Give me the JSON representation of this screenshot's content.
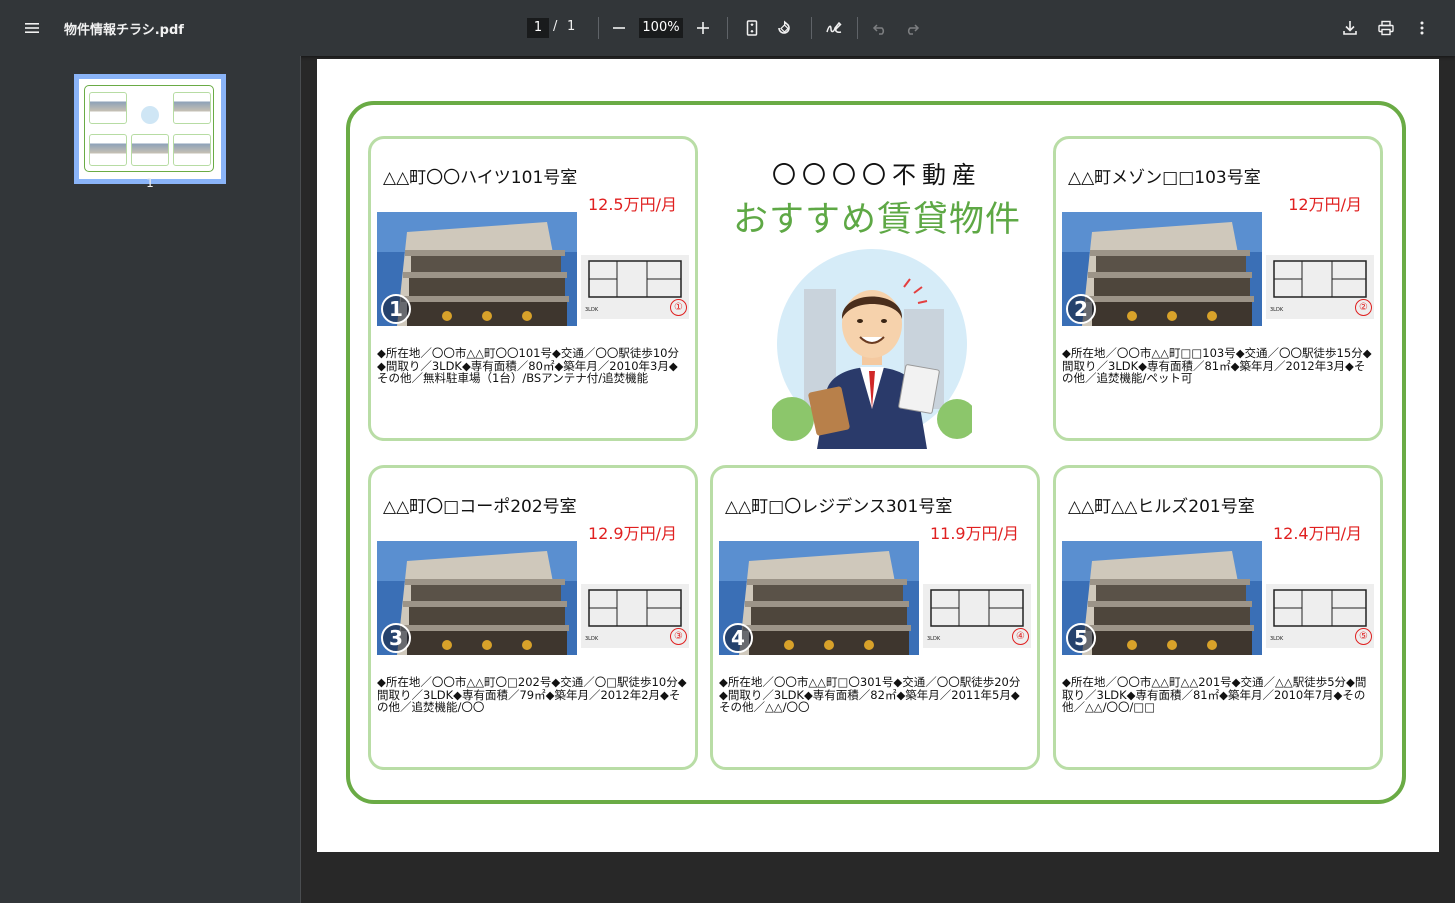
{
  "toolbar": {
    "menu_icon": "menu-icon",
    "document_title": "物件情報チラシ.pdf",
    "current_page": "1",
    "page_separator": "/",
    "total_pages": "1",
    "zoom": "100%"
  },
  "sidebar": {
    "thumbnails": [
      {
        "page_label": "1"
      }
    ]
  },
  "flyer": {
    "company": "〇〇〇〇不動産",
    "headline": "おすすめ賃貸物件",
    "accent_color": "#6aab45",
    "price_color": "#e02020",
    "cards": [
      {
        "title": "△△町〇〇ハイツ101号室",
        "price": "12.5万円/月",
        "photo_number": "1",
        "plan_number": "①",
        "plan_label": "3LDK",
        "description": "◆所在地／〇〇市△△町〇〇101号◆交通／〇〇駅徒歩10分◆間取り／3LDK◆専有面積／80㎡◆築年月／2010年3月◆その他／無料駐車場（1台）/BSアンテナ付/追焚機能"
      },
      {
        "title": "△△町メゾン□□103号室",
        "price": "12万円/月",
        "photo_number": "2",
        "plan_number": "②",
        "plan_label": "3LDK",
        "description": "◆所在地／〇〇市△△町□□103号◆交通／〇〇駅徒歩15分◆間取り／3LDK◆専有面積／81㎡◆築年月／2012年3月◆その他／追焚機能/ペット可"
      },
      {
        "title": "△△町〇□コーポ202号室",
        "price": "12.9万円/月",
        "photo_number": "3",
        "plan_number": "③",
        "plan_label": "3LDK",
        "description": "◆所在地／〇〇市△△町〇□202号◆交通／〇□駅徒歩10分◆間取り／3LDK◆専有面積／79㎡◆築年月／2012年2月◆その他／追焚機能/〇〇"
      },
      {
        "title": "△△町□〇レジデンス301号室",
        "price": "11.9万円/月",
        "photo_number": "4",
        "plan_number": "④",
        "plan_label": "3LDK",
        "description": "◆所在地／〇〇市△△町□〇301号◆交通／〇〇駅徒歩20分◆間取り／3LDK◆専有面積／82㎡◆築年月／2011年5月◆その他／△△/〇〇"
      },
      {
        "title": "△△町△△ヒルズ201号室",
        "price": "12.4万円/月",
        "photo_number": "5",
        "plan_number": "⑤",
        "plan_label": "3LDK",
        "description": "◆所在地／〇〇市△△町△△201号◆交通／△△駅徒歩5分◆間取り／3LDK◆専有面積／81㎡◆築年月／2010年7月◆その他／△△/〇〇/□□"
      }
    ]
  }
}
